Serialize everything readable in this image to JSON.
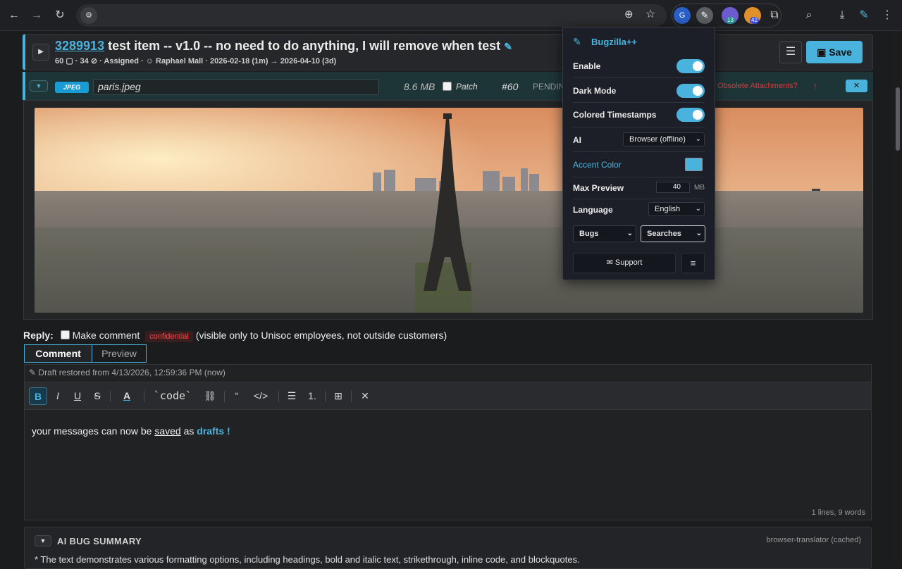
{
  "browser": {
    "back_icon": "arrow-left-icon",
    "forward_icon": "arrow-right-icon",
    "reload_icon": "reload-icon",
    "site_info_icon": "site-settings-icon",
    "extension_badges": {
      "grammarly": "",
      "translate_count": "13",
      "rss_count": "42"
    }
  },
  "bug": {
    "id": "3289913",
    "title": "test item -- v1.0 -- no need to do anything, I will remove when test",
    "comments": "60",
    "attachments": "34",
    "status": "Assigned",
    "assignee": "Raphael Mall",
    "created": "2026-02-18 (1m)",
    "due": "2026-04-10 (3d)",
    "save_label": "Save"
  },
  "attachment": {
    "type_badge": "JPEG",
    "filename": "paris.jpeg",
    "size": "8.6 MB",
    "patch_label": "Patch",
    "number": "#60",
    "status": "PENDIN",
    "obsolete_label": "Obsolete Attachments?",
    "close_label": "✕"
  },
  "reply": {
    "label": "Reply:",
    "make_comment": "Make comment",
    "confidential": "confidential",
    "visibility": "(visible only to Unisoc employees, not outside customers)"
  },
  "tabs": {
    "comment": "Comment",
    "preview": "Preview"
  },
  "editor": {
    "draft_note": "Draft restored from 4/13/2026, 12:59:36 PM (now)",
    "toolbar": {
      "bold": "B",
      "italic": "I",
      "underline": "U",
      "strike": "S",
      "color": "A",
      "code": "`code`",
      "quote": "“",
      "codeblock": "</>",
      "list": "☰",
      "olist": "1.",
      "table": "⊞",
      "clear": "✕"
    },
    "text_before": "your messages can now be ",
    "text_saved": "saved",
    "text_as": " as ",
    "text_drafts": "drafts !",
    "word_count": "1 lines, 9 words"
  },
  "ai_summary": {
    "title": "AI BUG SUMMARY",
    "source": "browser-translator (cached)",
    "text": "* The text demonstrates various formatting options, including headings, bold and italic text, strikethrough, inline code, and blockquotes."
  },
  "popup": {
    "title": "Bugzilla++",
    "enable": "Enable",
    "dark_mode": "Dark Mode",
    "colored_timestamps": "Colored Timestamps",
    "ai_label": "AI",
    "ai_value": "Browser (offline)",
    "accent_label": "Accent Color",
    "accent_color": "#4ab3dd",
    "max_preview_label": "Max Preview",
    "max_preview_value": "40",
    "max_preview_unit": "MB",
    "language_label": "Language",
    "language_value": "English",
    "bugs_label": "Bugs",
    "searches_label": "Searches",
    "support_label": "Support",
    "toggles": {
      "enable": true,
      "dark_mode": true,
      "colored_timestamps": true
    }
  }
}
